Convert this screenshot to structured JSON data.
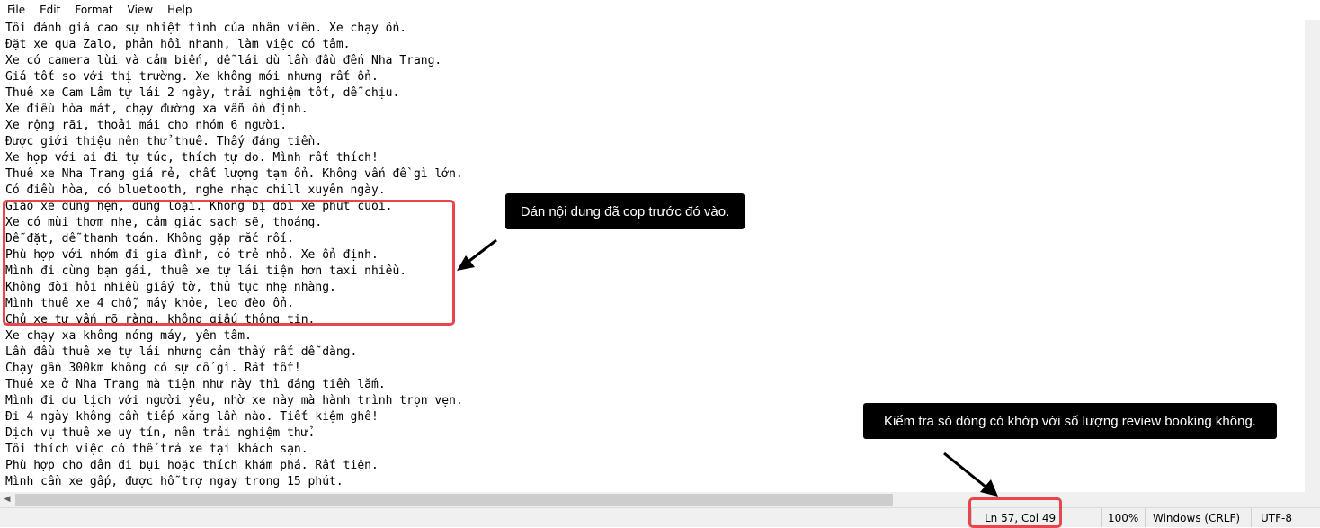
{
  "menu": [
    "File",
    "Edit",
    "Format",
    "View",
    "Help"
  ],
  "editor": {
    "lines": [
      "Tôi đánh giá cao sự nhiệt tình của nhân viên. Xe chạy ổn.",
      "Đặt xe qua Zalo, phản hồi nhanh, làm việc có tâm.",
      "Xe có camera lùi và cảm biến, dễ lái dù lần đầu đến Nha Trang.",
      "Giá tốt so với thị trường. Xe không mới nhưng rất ổn.",
      "Thuê xe Cam Lâm tự lái 2 ngày, trải nghiệm tốt, dễ chịu.",
      "Xe điều hòa mát, chạy đường xa vẫn ổn định.",
      "Xe rộng rãi, thoải mái cho nhóm 6 người.",
      "Được giới thiệu nên thử thuê. Thấy đáng tiền.",
      "Xe hợp với ai đi tự túc, thích tự do. Mình rất thích!",
      "Thuê xe Nha Trang giá rẻ, chất lượng tạm ổn. Không vấn đề gì lớn.",
      "Có điều hòa, có bluetooth, nghe nhạc chill xuyên ngày.",
      "Giao xe đúng hẹn, đúng loại. Không bị đổi xe phút cuối.",
      "Xe có mùi thơm nhẹ, cảm giác sạch sẽ, thoáng.",
      "Dễ đặt, dễ thanh toán. Không gặp rắc rối.",
      "Phù hợp với nhóm đi gia đình, có trẻ nhỏ. Xe ổn định.",
      "Mình đi cùng bạn gái, thuê xe tự lái tiện hơn taxi nhiều.",
      "Không đòi hỏi nhiều giấy tờ, thủ tục nhẹ nhàng.",
      "Mình thuê xe 4 chỗ, máy khỏe, leo đèo ổn.",
      "Chủ xe tư vấn rõ ràng, không giấu thông tin.",
      "Xe chạy xa không nóng máy, yên tâm.",
      "Lần đầu thuê xe tự lái nhưng cảm thấy rất dễ dàng.",
      "Chạy gần 300km không có sự cố gì. Rất tốt!",
      "Thuê xe ở Nha Trang mà tiện như này thì đáng tiền lắm.",
      "Mình đi du lịch với người yêu, nhờ xe này mà hành trình trọn vẹn.",
      "Đi 4 ngày không cần tiếp xăng lần nào. Tiết kiệm ghê!",
      "Dịch vụ thuê xe uy tín, nên trải nghiệm thử.",
      "Tôi thích việc có thể trả xe tại khách sạn.",
      "Phù hợp cho dân đi bụi hoặc thích khám phá. Rất tiện.",
      "Mình cần xe gấp, được hỗ trợ ngay trong 15 phút."
    ]
  },
  "status": {
    "position": "Ln 57, Col 49",
    "zoom": "100%",
    "line_ending": "Windows (CRLF)",
    "encoding": "UTF-8"
  },
  "annotations": {
    "paste_note": "Dán nội dung đã cop trước đó vào.",
    "check_note": "Kiểm tra só dòng có khớp với số lượng review booking không."
  },
  "colors": {
    "highlight": "#e9454c",
    "callout_bg": "#000000"
  },
  "icons": {
    "scroll_left": "triangle-left"
  }
}
